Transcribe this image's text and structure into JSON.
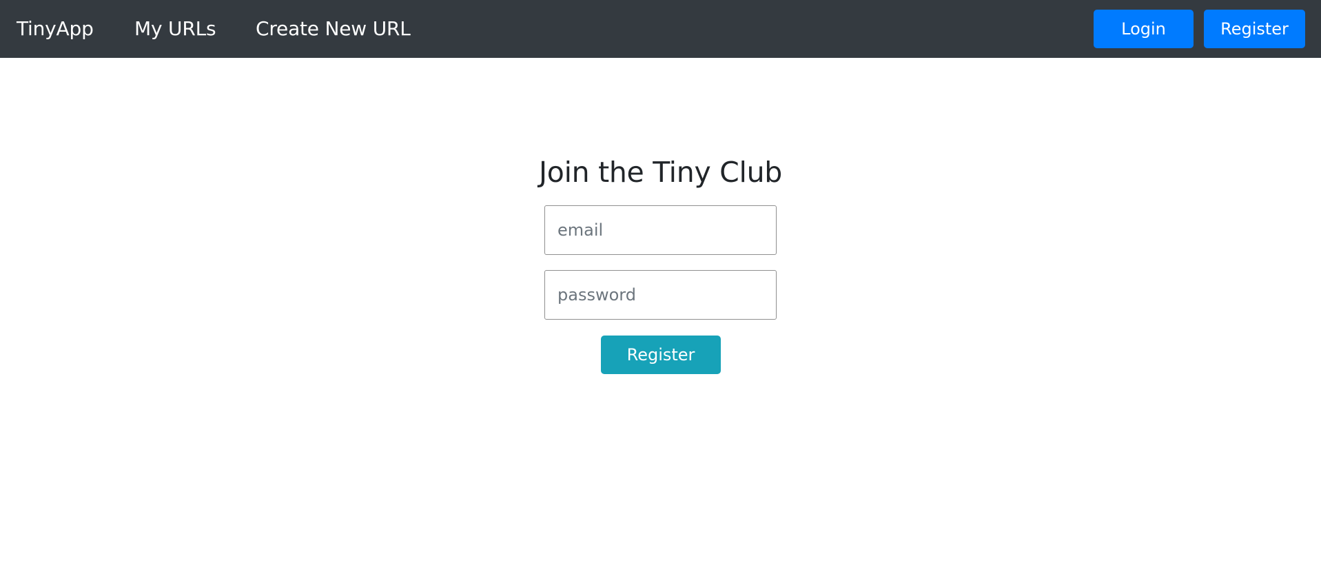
{
  "navbar": {
    "brand": "TinyApp",
    "links": [
      {
        "label": "My URLs"
      },
      {
        "label": "Create New URL"
      }
    ],
    "login_label": "Login",
    "register_label": "Register",
    "background_color": "#343a40",
    "button_color": "#007bff"
  },
  "form": {
    "title": "Join the Tiny Club",
    "email_placeholder": "email",
    "password_placeholder": "password",
    "submit_label": "Register",
    "submit_color": "#17a2b8"
  }
}
